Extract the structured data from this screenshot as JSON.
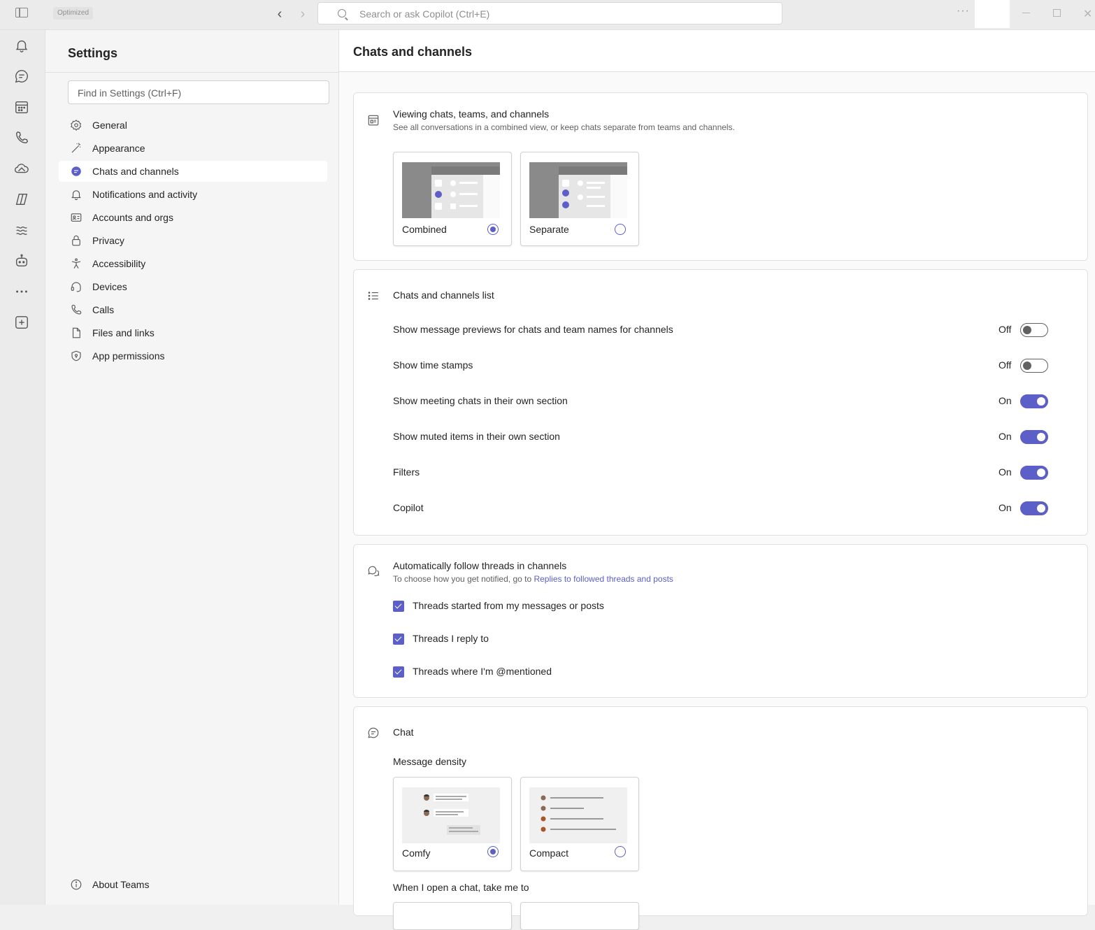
{
  "titlebar": {
    "badge": "Optimized",
    "search_placeholder": "Search or ask Copilot (Ctrl+E)",
    "more": "···"
  },
  "rail": {
    "items": [
      "activity-icon",
      "chat-icon",
      "calendar-icon",
      "calls-icon",
      "onedrive-icon",
      "copilot-icon",
      "viva-icon",
      "bot-icon",
      "more-apps-icon",
      "add-apps-icon"
    ]
  },
  "settings": {
    "title": "Settings",
    "find_placeholder": "Find in Settings (Ctrl+F)",
    "items": [
      {
        "label": "General",
        "icon": "gear-icon"
      },
      {
        "label": "Appearance",
        "icon": "wand-icon"
      },
      {
        "label": "Chats and channels",
        "icon": "chat-bubble-icon"
      },
      {
        "label": "Notifications and activity",
        "icon": "bell-icon"
      },
      {
        "label": "Accounts and orgs",
        "icon": "id-card-icon"
      },
      {
        "label": "Privacy",
        "icon": "lock-icon"
      },
      {
        "label": "Accessibility",
        "icon": "accessibility-icon"
      },
      {
        "label": "Devices",
        "icon": "headset-icon"
      },
      {
        "label": "Calls",
        "icon": "phone-icon"
      },
      {
        "label": "Files and links",
        "icon": "document-icon"
      },
      {
        "label": "App permissions",
        "icon": "shield-icon"
      }
    ],
    "active_index": 2,
    "about": "About Teams"
  },
  "main": {
    "title": "Chats and channels",
    "viewing": {
      "title": "Viewing chats, teams, and channels",
      "subtitle": "See all conversations in a combined view, or keep chats separate from teams and channels.",
      "options": [
        {
          "label": "Combined",
          "selected": true
        },
        {
          "label": "Separate",
          "selected": false
        }
      ]
    },
    "list": {
      "title": "Chats and channels list",
      "toggles": [
        {
          "label": "Show message previews for chats and team names for channels",
          "state": "Off",
          "on": false
        },
        {
          "label": "Show time stamps",
          "state": "Off",
          "on": false
        },
        {
          "label": "Show meeting chats in their own section",
          "state": "On",
          "on": true
        },
        {
          "label": "Show muted items in their own section",
          "state": "On",
          "on": true
        },
        {
          "label": "Filters",
          "state": "On",
          "on": true
        },
        {
          "label": "Copilot",
          "state": "On",
          "on": true
        }
      ]
    },
    "follow": {
      "title": "Automatically follow threads in channels",
      "subtitle_prefix": "To choose how you get notified, go to ",
      "subtitle_link": "Replies to followed threads and posts",
      "checks": [
        {
          "label": "Threads started from my messages or posts",
          "checked": true
        },
        {
          "label": "Threads I reply to",
          "checked": true
        },
        {
          "label": "Threads where I'm @mentioned",
          "checked": true
        }
      ]
    },
    "chat": {
      "title": "Chat",
      "density_label": "Message density",
      "options": [
        {
          "label": "Comfy",
          "selected": true
        },
        {
          "label": "Compact",
          "selected": false
        }
      ],
      "open_label": "When I open a chat, take me to"
    }
  },
  "colors": {
    "accent": "#5b5fc7",
    "text": "#242424",
    "subtle": "#616161"
  }
}
